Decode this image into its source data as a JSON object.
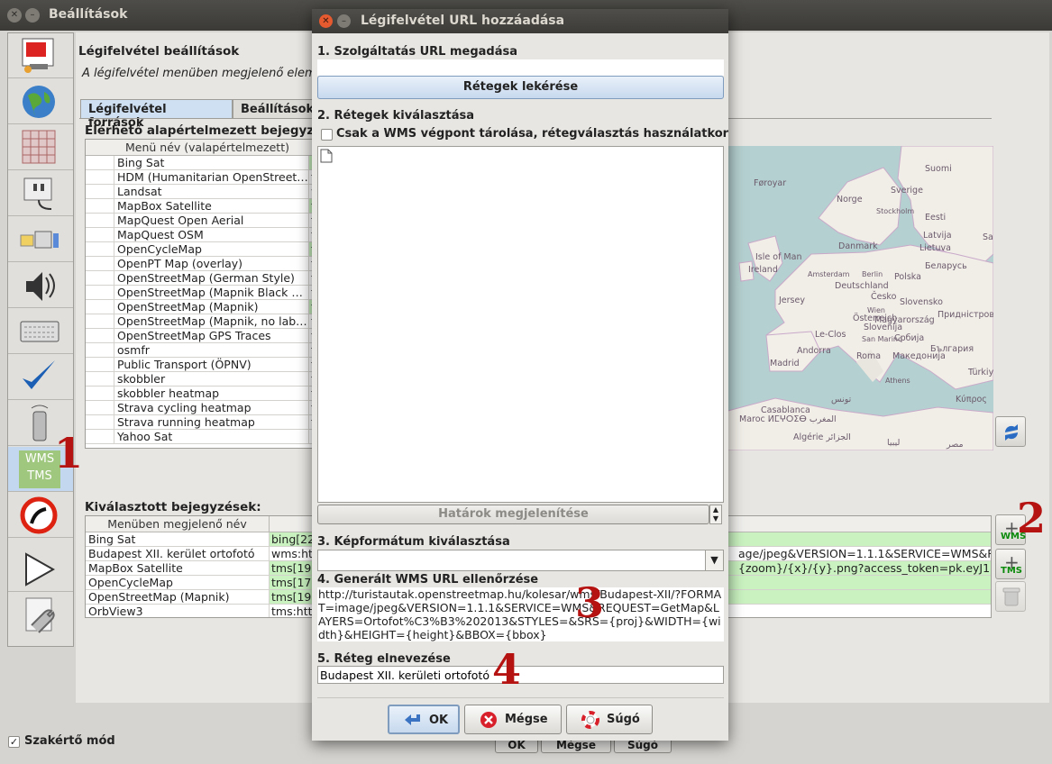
{
  "window": {
    "title": "Beállítások"
  },
  "sidebar": {
    "items": [
      {
        "icon": "display-settings-icon"
      },
      {
        "icon": "globe-icon"
      },
      {
        "icon": "grid-icon"
      },
      {
        "icon": "plugin-icon"
      },
      {
        "icon": "folders-icon"
      },
      {
        "icon": "audio-icon"
      },
      {
        "icon": "keyboard-icon"
      },
      {
        "icon": "checkmark-icon"
      },
      {
        "icon": "remote-control-icon"
      },
      {
        "icon": "wms-tms-icon",
        "label_line1": "WMS",
        "label_line2": "TMS"
      },
      {
        "icon": "no-entry-icon"
      },
      {
        "icon": "play-icon"
      },
      {
        "icon": "wrench-document-icon"
      }
    ]
  },
  "main": {
    "heading": "Légifelvétel beállítások",
    "description": "A légifelvétel menüben megjelenő elemek",
    "tabs": [
      {
        "label": "Légifelvétel források"
      },
      {
        "label": "Beállítások"
      }
    ],
    "available_label": "Elérhető alapértelmezett bejegyzés",
    "available_col_name": "Menü név (valapértelmezett)",
    "available_rows": [
      {
        "name": "Bing Sat",
        "tag": "b"
      },
      {
        "name": "HDM (Humanitarian OpenStreet…",
        "tag": "t"
      },
      {
        "name": "Landsat",
        "tag": "w"
      },
      {
        "name": "MapBox Satellite",
        "tag": "t"
      },
      {
        "name": "MapQuest Open Aerial",
        "tag": "t"
      },
      {
        "name": "MapQuest OSM",
        "tag": "t"
      },
      {
        "name": "OpenCycleMap",
        "tag": "t"
      },
      {
        "name": "OpenPT Map (overlay)",
        "tag": "t"
      },
      {
        "name": "OpenStreetMap (German Style)",
        "tag": "t"
      },
      {
        "name": "OpenStreetMap (Mapnik Black …",
        "tag": "t"
      },
      {
        "name": "OpenStreetMap (Mapnik)",
        "tag": "t"
      },
      {
        "name": "OpenStreetMap (Mapnik, no lab…",
        "tag": "t"
      },
      {
        "name": "OpenStreetMap GPS Traces",
        "tag": "t"
      },
      {
        "name": "osmfr",
        "tag": "t"
      },
      {
        "name": "Public Transport (ÖPNV)",
        "tag": "t"
      },
      {
        "name": "skobbler",
        "tag": "t"
      },
      {
        "name": "skobbler heatmap",
        "tag": "t"
      },
      {
        "name": "Strava cycling heatmap",
        "tag": "t"
      },
      {
        "name": "Strava running heatmap",
        "tag": "t"
      },
      {
        "name": "Yahoo Sat",
        "tag": "h"
      }
    ],
    "selected_label": "Kiválasztott bejegyzések:",
    "selected_col_name": "Menüben megjelenő név",
    "selected_rows": [
      {
        "name": "Bing Sat",
        "url": "bing[22",
        "green": true
      },
      {
        "name": "Budapest XII. kerület ortofotó",
        "url": "wms:htt",
        "tail": "age/jpeg&VERSION=1.1.1&SERVICE=WMS&R…",
        "green": false
      },
      {
        "name": "MapBox Satellite",
        "url": "tms[19]",
        "tail": "{zoom}/{x}/{y}.png?access_token=pk.eyJ1Ij…",
        "green": true
      },
      {
        "name": "OpenCycleMap",
        "url": "tms[17]",
        "green": true
      },
      {
        "name": "OpenStreetMap (Mapnik)",
        "url": "tms[19]",
        "green": true
      },
      {
        "name": "OrbView3",
        "url": "tms:http",
        "green": false
      }
    ],
    "expert_mode_label": "Szakértő mód",
    "bottom_buttons": [
      {
        "label": "OK"
      },
      {
        "label": "Mégse"
      },
      {
        "label": "Súgó"
      }
    ],
    "side_buttons": {
      "add_wms": "WMS",
      "add_tms": "TMS"
    }
  },
  "map_labels": [
    {
      "text": "Suomi"
    },
    {
      "text": "Føroyar"
    },
    {
      "text": "Norge"
    },
    {
      "text": "Sverige"
    },
    {
      "text": "Stockholm"
    },
    {
      "text": "Eesti"
    },
    {
      "text": "Latvija"
    },
    {
      "text": "Danmark"
    },
    {
      "text": "Lietuva"
    },
    {
      "text": "Isle of Man"
    },
    {
      "text": "Ireland"
    },
    {
      "text": "Amsterdam"
    },
    {
      "text": "Berlin"
    },
    {
      "text": "Беларусь"
    },
    {
      "text": "Polska"
    },
    {
      "text": "Deutschland"
    },
    {
      "text": "Česko"
    },
    {
      "text": "Jersey"
    },
    {
      "text": "Slovensko"
    },
    {
      "text": "Wien"
    },
    {
      "text": "Österreich"
    },
    {
      "text": "Magyarország"
    },
    {
      "text": "Придністровсь"
    },
    {
      "text": "Slovenija"
    },
    {
      "text": "Le-Clos"
    },
    {
      "text": "San Marino"
    },
    {
      "text": "Србија"
    },
    {
      "text": "България"
    },
    {
      "text": "Andorra"
    },
    {
      "text": "Македонија"
    },
    {
      "text": "Roma"
    },
    {
      "text": "Madrid"
    },
    {
      "text": "Türkiye"
    },
    {
      "text": "Athens"
    },
    {
      "text": "Κύπρος"
    },
    {
      "text": "تونس"
    },
    {
      "text": "Casablanca"
    },
    {
      "text": "Maroc ⵍⵎⵖⵔⵉⴱ المغرب"
    },
    {
      "text": "Algérie الجزائر"
    },
    {
      "text": "ليبيا"
    },
    {
      "text": "مصر"
    },
    {
      "text": "Sa"
    }
  ],
  "annotations": [
    "1",
    "2",
    "3",
    "4"
  ],
  "dialog": {
    "title": "Légifelvétel URL hozzáadása",
    "step1": "1. Szolgáltatás URL megadása",
    "url_value": "",
    "fetch_layers_button": "Rétegek lekérése",
    "step2": "2. Rétegek kiválasztása",
    "wms_only_checkbox": "Csak a WMS végpont tárolása, rétegválasztás használatkor",
    "show_bounds_button": "Határok megjelenítése",
    "step3": "3. Képformátum kiválasztása",
    "format_value": "",
    "step4": "4. Generált WMS URL ellenőrzése",
    "generated_url": "http://turistautak.openstreetmap.hu/kolesar/wms/Budapest-XII/?FORMAT=image/jpeg&VERSION=1.1.1&SERVICE=WMS&REQUEST=GetMap&LAYERS=Ortofot%C3%B3%202013&STYLES=&SRS={proj}&WIDTH={width}&HEIGHT={height}&BBOX={bbox}",
    "step5": "5. Réteg elnevezése",
    "layer_name": "Budapest XII. kerületi ortofotó",
    "ok_label": "OK",
    "cancel_label": "Mégse",
    "help_label": "Súgó"
  },
  "colors": {
    "accent_blue": "#c3d7ef",
    "row_green": "#c9f2c0",
    "annotation_red": "#b51212"
  }
}
